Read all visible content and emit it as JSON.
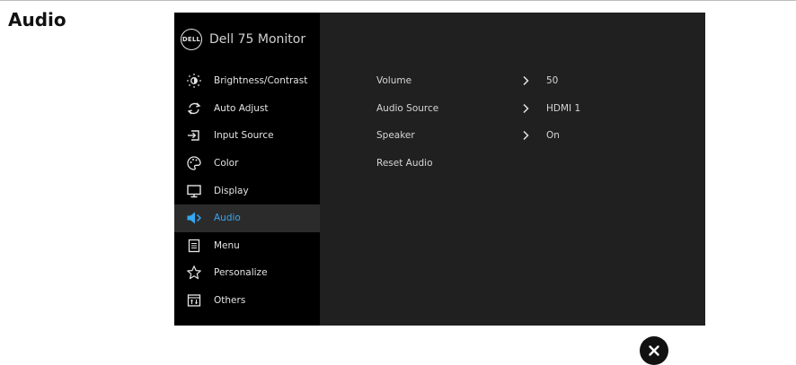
{
  "page": {
    "section_title": "Audio"
  },
  "osd": {
    "brand": {
      "logo_text": "DELL",
      "model": "Dell 75 Monitor"
    },
    "menu": [
      {
        "label": "Brightness/Contrast",
        "icon": "brightness-icon"
      },
      {
        "label": "Auto Adjust",
        "icon": "auto-adjust-icon"
      },
      {
        "label": "Input Source",
        "icon": "input-source-icon"
      },
      {
        "label": "Color",
        "icon": "color-palette-icon"
      },
      {
        "label": "Display",
        "icon": "display-monitor-icon"
      },
      {
        "label": "Audio",
        "icon": "speaker-icon",
        "active": true
      },
      {
        "label": "Menu",
        "icon": "menu-list-icon"
      },
      {
        "label": "Personalize",
        "icon": "star-icon"
      },
      {
        "label": "Others",
        "icon": "others-icon"
      }
    ],
    "options": [
      {
        "label": "Volume",
        "value": "50",
        "has_submenu": true
      },
      {
        "label": "Audio Source",
        "value": "HDMI 1",
        "has_submenu": true
      },
      {
        "label": "Speaker",
        "value": "On",
        "has_submenu": true
      },
      {
        "label": "Reset Audio",
        "value": "",
        "has_submenu": false
      }
    ],
    "colors": {
      "active": "#35a7f4",
      "panel": "#202020",
      "sidebar": "#000000"
    }
  },
  "close": {
    "icon": "close-icon"
  }
}
